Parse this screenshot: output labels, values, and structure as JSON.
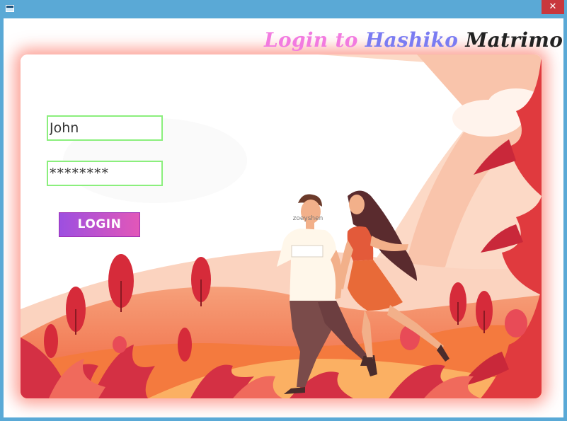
{
  "titlebar": {
    "close_glyph": "✕",
    "icon": "window-app-icon"
  },
  "heading": {
    "part1": "Login to ",
    "part2": "Hashiko ",
    "part3": "Matrimonial"
  },
  "form": {
    "username_value": "John",
    "password_value": "********",
    "login_label": "LOGIN"
  },
  "illustration": {
    "shirt_text": "zoeyshen"
  },
  "colors": {
    "titlebar": "#5aa9d6",
    "close_button": "#c8373d",
    "heading_pink": "#f27be0",
    "heading_purple": "#7b7cf2",
    "field_border": "#8bef7d",
    "button_start": "#9d4fe0",
    "button_end": "#e257b8"
  }
}
